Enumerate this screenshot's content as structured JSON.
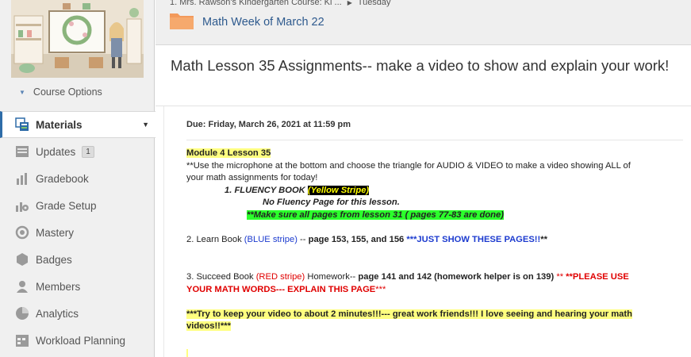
{
  "sidebar": {
    "course_options": "Course Options",
    "items": [
      {
        "label": "Materials",
        "icon": "materials-icon",
        "active": true
      },
      {
        "label": "Updates",
        "icon": "updates-icon",
        "badge": "1"
      },
      {
        "label": "Gradebook",
        "icon": "gradebook-icon"
      },
      {
        "label": "Grade Setup",
        "icon": "grade-setup-icon"
      },
      {
        "label": "Mastery",
        "icon": "mastery-icon"
      },
      {
        "label": "Badges",
        "icon": "badges-icon"
      },
      {
        "label": "Members",
        "icon": "members-icon"
      },
      {
        "label": "Analytics",
        "icon": "analytics-icon"
      },
      {
        "label": "Workload Planning",
        "icon": "workload-planning-icon"
      }
    ]
  },
  "header": {
    "breadcrumb": [
      "1. Mrs. Rawson's Kindergarten Course: Ki ...",
      "Tuesday"
    ],
    "folder_title": "Math Week of March 22"
  },
  "page": {
    "title": "Math Lesson 35 Assignments-- make a video to show and explain your work!",
    "due": "Due: Friday, March 26, 2021 at 11:59 pm"
  },
  "body": {
    "module": "Module 4  Lesson 35",
    "instr_1": "**Use the microphone at the bottom and choose the triangle for AUDIO & VIDEO to make a video showing ALL of",
    "instr_2": "your math assignments for today!",
    "fluency_1": "1. FLUENCY BOOK",
    "fluency_2": "(Yellow Stripe)",
    "no_fluency": "No Fluency Page for this lesson.",
    "make_sure": "**Make sure all pages from lesson 31 ( pages 77-83 are done)",
    "learn_1": "2.  Learn Book ",
    "learn_2": "(BLUE stripe)",
    "learn_3": " -- ",
    "learn_4": "page 153, 155, and 156",
    "learn_5": " ***JUST SHOW THESE PAGES!!",
    "learn_6": "**",
    "succeed_1": "3. Succeed Book ",
    "succeed_2": "(RED stripe)",
    "succeed_3": " Homework-- ",
    "succeed_4": "page 141 and 142  (homework helper is on 139)",
    "succeed_5": " ** ",
    "succeed_6": "**PLEASE USE",
    "succeed_7": "YOUR MATH WORDS--- EXPLAIN THIS PAGE",
    "succeed_8": "***",
    "closing_1": "***Try to keep your video to about 2 minutes!!!--- great work friends!!!  I love seeing and hearing your math",
    "closing_2": "videos!!***"
  },
  "colors": {
    "accent": "#2e6ca8",
    "highlight_yellow": "#ffff80",
    "highlight_green": "#2bff2b",
    "blue_text": "#1c3bcf",
    "red_text": "#e00000",
    "folder_orange": "#f39a5b"
  }
}
